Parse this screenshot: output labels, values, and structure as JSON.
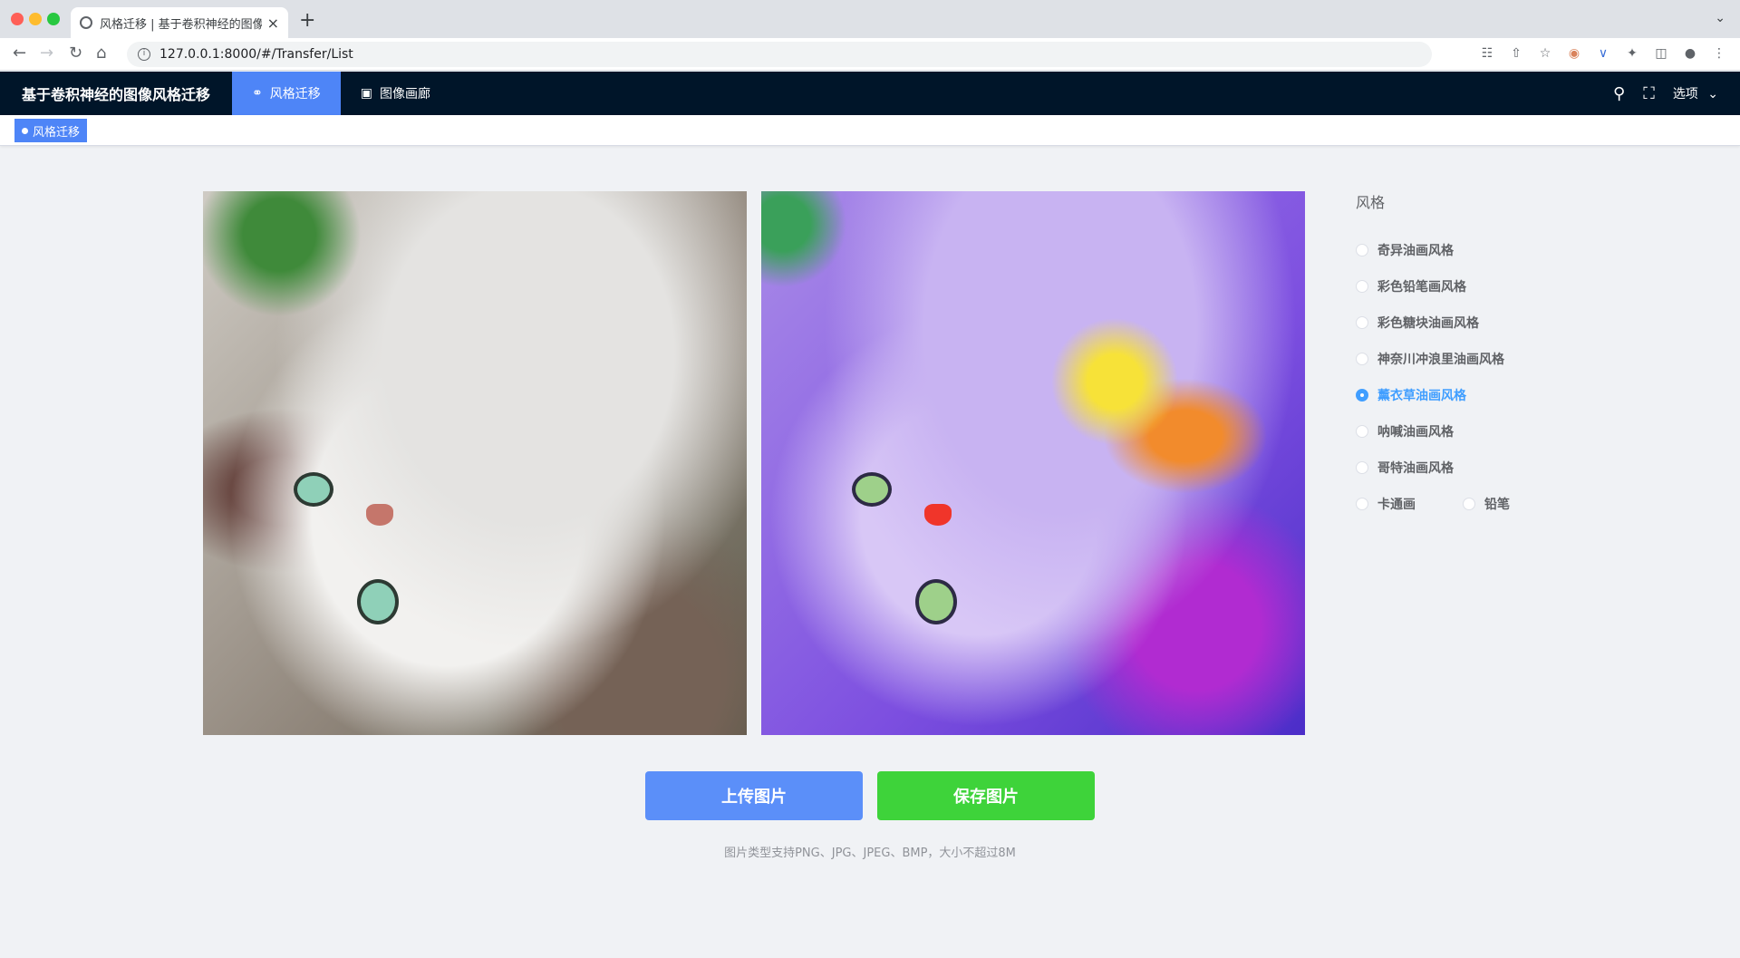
{
  "browser": {
    "tab_title": "风格迁移 | 基于卷积神经的图像风",
    "tab_close": "×",
    "new_tab": "+",
    "url": "127.0.0.1:8000/#/Transfer/List",
    "nav_icons": [
      "back-arrow-icon",
      "forward-arrow-icon",
      "reload-icon",
      "home-icon"
    ],
    "toolbar_icons": [
      "translate-icon",
      "share-icon",
      "bookmark-star-icon",
      "extension-avatar-icon",
      "extension-icon",
      "puzzle-icon",
      "sidepanel-icon",
      "profile-icon",
      "more-icon"
    ]
  },
  "header": {
    "brand": "基于卷积神经的图像风格迁移",
    "nav": [
      {
        "label": "风格迁移",
        "icon": "style-transfer-icon",
        "active": true
      },
      {
        "label": "图像画廊",
        "icon": "image-icon",
        "active": false
      }
    ],
    "options_label": "选项"
  },
  "tags": {
    "active_tag": "风格迁移"
  },
  "style_panel": {
    "title": "风格",
    "options": [
      {
        "label": "奇异油画风格",
        "checked": false
      },
      {
        "label": "彩色铅笔画风格",
        "checked": false
      },
      {
        "label": "彩色糖块油画风格",
        "checked": false
      },
      {
        "label": "神奈川冲浪里油画风格",
        "checked": false
      },
      {
        "label": "薰衣草油画风格",
        "checked": true
      },
      {
        "label": "呐喊油画风格",
        "checked": false
      },
      {
        "label": "哥特油画风格",
        "checked": false
      },
      {
        "label": "卡通画",
        "checked": false
      },
      {
        "label": "铅笔",
        "checked": false
      }
    ]
  },
  "buttons": {
    "upload": "上传图片",
    "save": "保存图片"
  },
  "hint": "图片类型支持PNG、JPG、JPEG、BMP，大小不超过8M",
  "colors": {
    "header_bg": "#001529",
    "accent": "#4e85f7",
    "upload_btn": "#5b8ff9",
    "save_btn": "#3ed33a",
    "radio_checked": "#409eff"
  }
}
